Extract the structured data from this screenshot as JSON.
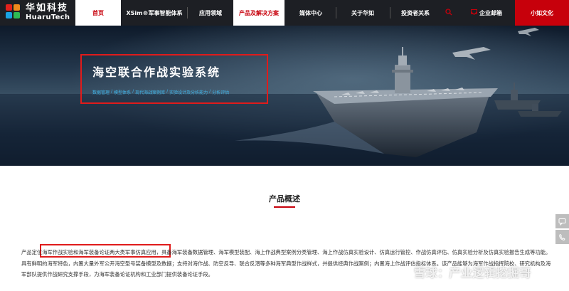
{
  "logo": {
    "cn": "华如科技",
    "en": "HuaruTech"
  },
  "nav": {
    "items": [
      {
        "label": "首页"
      },
      {
        "label": "XSim®军事智能体系"
      },
      {
        "label": "应用领域"
      },
      {
        "label": "产品及解决方案"
      },
      {
        "label": "媒体中心"
      },
      {
        "label": "关于华如"
      },
      {
        "label": "投资者关系"
      }
    ],
    "active": "产品及解决方案",
    "mail_label": "企业邮箱",
    "cta_label": "小如文化"
  },
  "hero": {
    "title": "海空联合作战实验系统",
    "tags": [
      "数据管理",
      "模型体系",
      "现代海战案例库",
      "实验设计及分析能力",
      "分析评估"
    ],
    "tag_separator": "/"
  },
  "section": {
    "title": "产品概述"
  },
  "overview": {
    "prefix": "产品定位",
    "highlight": "海军作战实验和海军装备论证两大类军事仿真应用",
    "body": "，具备海军装备数据管理、海军模型装配、海上作战典型案例分类管理、海上作战仿真实验设计、仿真运行管控、作战仿真评估、仿真实验分析及仿真实验报告生成等功能。具有鲜明的海军特色，内置大量外军公开海空型号装备模型及数据；支持对海作战、防空反导、联合反潜等多种海军典型作战样式，并提供经典作战案例；内置海上作战评估指标体系。该产品能够为海军作战指挥院校、研究机构及海军部队提供作战研究支撑手段，为海军装备论证机构和工业部门提供装备论证手段。"
  },
  "watermark": "雪球：产业逻辑挖掘哥",
  "colors": {
    "brand_red": "#c7000b",
    "nav_bg": "#1d1f24",
    "tag_blue": "#40b4e8",
    "highlight_box": "#e01b1b"
  },
  "icons": [
    "logo-mark-icon",
    "search-icon",
    "mail-icon",
    "chat-icon",
    "phone-icon"
  ]
}
